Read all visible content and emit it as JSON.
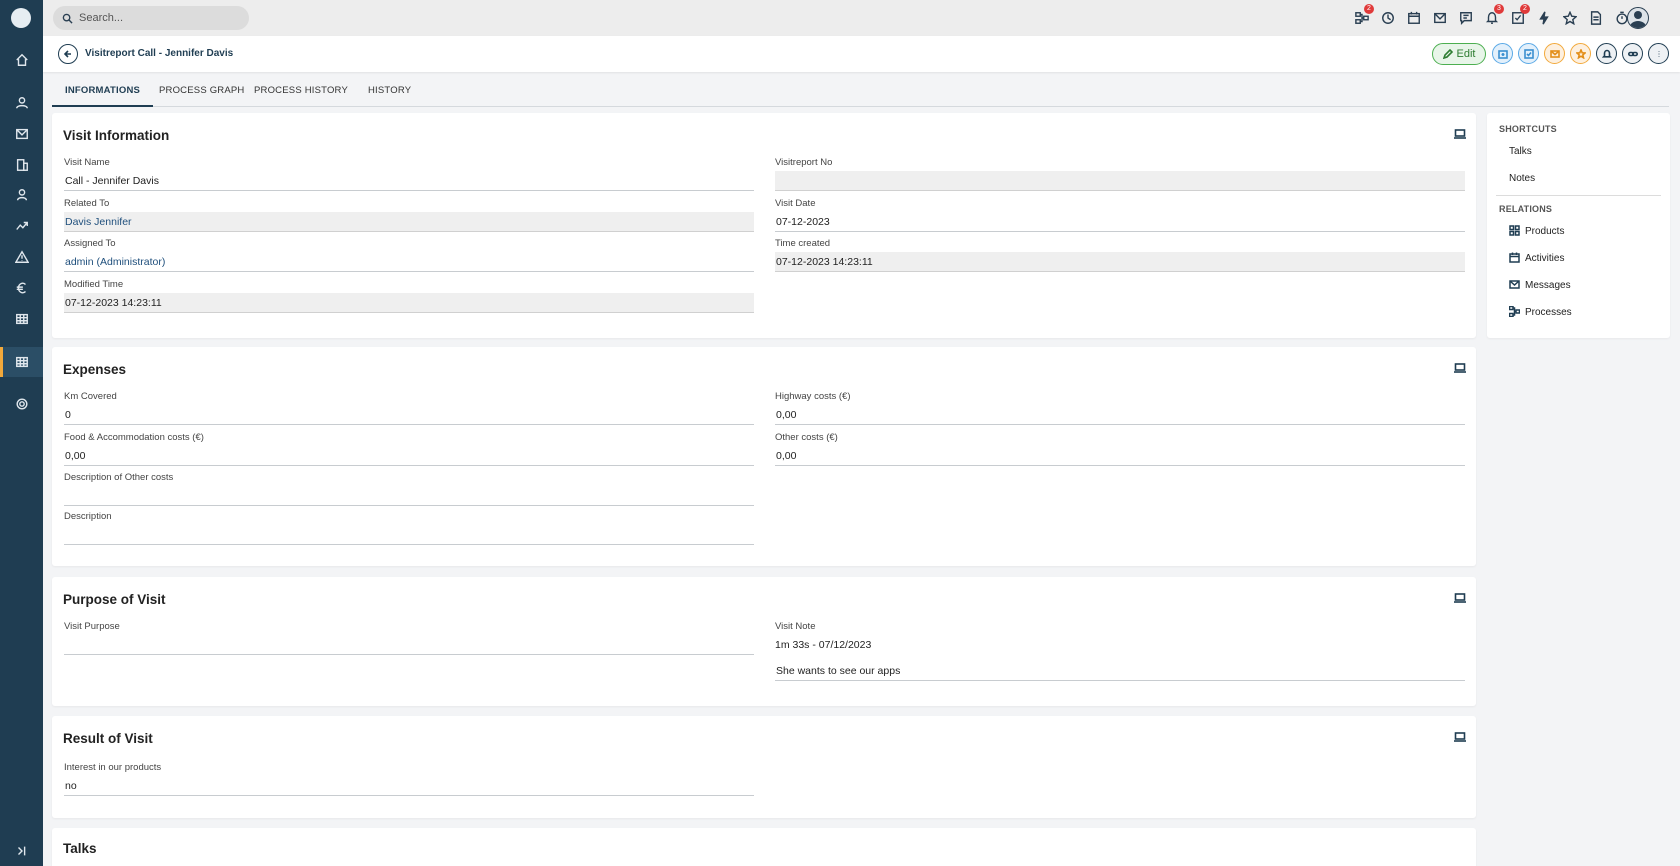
{
  "search": {
    "placeholder": "Search..."
  },
  "topbar": {
    "icons": [
      "processes-icon",
      "history-icon",
      "calendar-icon",
      "mail-icon",
      "chat-icon",
      "bell-icon",
      "tasks-icon",
      "flash-icon",
      "star-icon",
      "document-icon",
      "timer-icon"
    ],
    "badges": {
      "processes": "2",
      "notifications": "3",
      "tasks": "2"
    }
  },
  "header": {
    "title": "Visitreport Call - Jennifer Davis",
    "edit_label": "Edit"
  },
  "tabs": [
    "INFORMATIONS",
    "PROCESS GRAPH",
    "PROCESS HISTORY",
    "HISTORY"
  ],
  "visit_information": {
    "title": "Visit Information",
    "visit_name_label": "Visit Name",
    "visit_name": "Call - Jennifer Davis",
    "visitreport_no_label": "Visitreport No",
    "visitreport_no": "",
    "related_to_label": "Related To",
    "related_to": "Davis Jennifer",
    "visit_date_label": "Visit Date",
    "visit_date": "07-12-2023",
    "assigned_to_label": "Assigned To",
    "assigned_to": "admin (Administrator)",
    "time_created_label": "Time created",
    "time_created": "07-12-2023 14:23:11",
    "modified_time_label": "Modified Time",
    "modified_time": "07-12-2023 14:23:11"
  },
  "expenses": {
    "title": "Expenses",
    "km_label": "Km Covered",
    "km": "0",
    "highway_label": "Highway costs (€)",
    "highway": "0,00",
    "food_label": "Food & Accommodation costs (€)",
    "food": "0,00",
    "other_label": "Other costs (€)",
    "other": "0,00",
    "desc_other_label": "Description of Other costs",
    "desc_other": "",
    "description_label": "Description",
    "description": ""
  },
  "purpose": {
    "title": "Purpose of Visit",
    "visit_purpose_label": "Visit Purpose",
    "visit_purpose": "",
    "visit_note_label": "Visit Note",
    "visit_note_line1": "1m 33s - 07/12/2023",
    "visit_note_line2": "She wants to see our apps"
  },
  "result": {
    "title": "Result of Visit",
    "interest_label": "Interest in our products",
    "interest": "no"
  },
  "talks": {
    "title": "Talks"
  },
  "shortcuts": {
    "heading": "SHORTCUTS",
    "items": [
      "Talks",
      "Notes"
    ]
  },
  "relations": {
    "heading": "RELATIONS",
    "items": [
      "Products",
      "Activities",
      "Messages",
      "Processes"
    ]
  }
}
